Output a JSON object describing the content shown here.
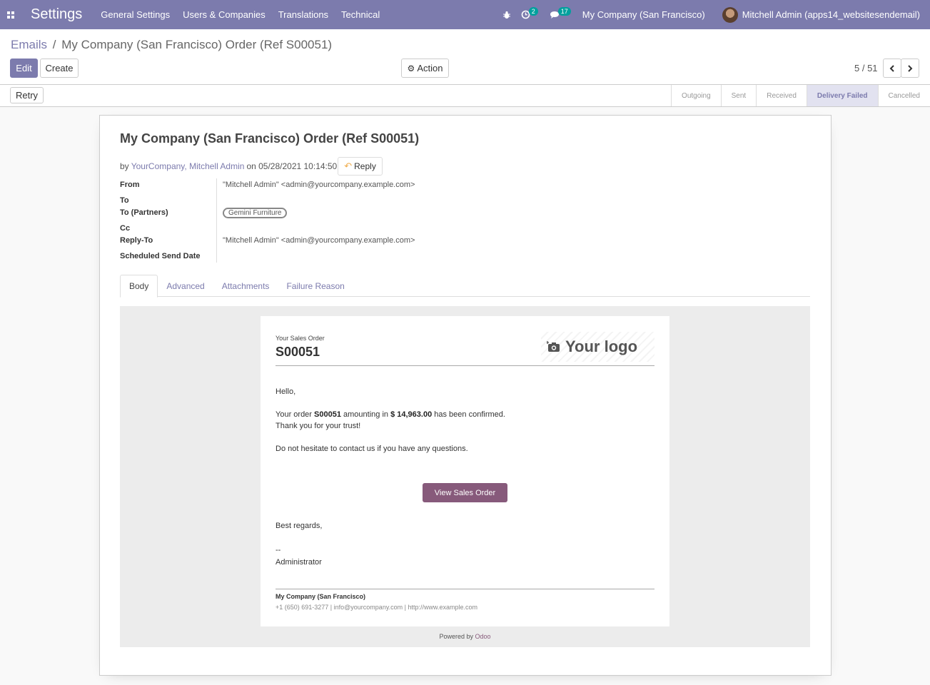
{
  "navbar": {
    "brand": "Settings",
    "menu": [
      "General Settings",
      "Users & Companies",
      "Translations",
      "Technical"
    ],
    "activity_count": "2",
    "message_count": "17",
    "company": "My Company (San Francisco)",
    "user": "Mitchell Admin (apps14_websitesendemail)"
  },
  "breadcrumb": {
    "parent": "Emails",
    "separator": "/",
    "current": "My Company (San Francisco) Order (Ref S00051)"
  },
  "buttons": {
    "edit": "Edit",
    "create": "Create",
    "action": "Action",
    "retry": "Retry"
  },
  "pager": {
    "value": "5 / 51"
  },
  "stages": [
    {
      "label": "Outgoing",
      "active": false
    },
    {
      "label": "Sent",
      "active": false
    },
    {
      "label": "Received",
      "active": false
    },
    {
      "label": "Delivery Failed",
      "active": true
    },
    {
      "label": "Cancelled",
      "active": false
    }
  ],
  "record": {
    "title": "My Company (San Francisco) Order (Ref S00051)",
    "by_prefix": "by",
    "authors": "YourCompany, Mitchell Admin",
    "on_date": "on 05/28/2021 10:14:50",
    "reply_label": "Reply"
  },
  "fields": {
    "from_label": "From",
    "from_value": "\"Mitchell Admin\" <admin@yourcompany.example.com>",
    "to_label": "To",
    "to_partners_label": "To (Partners)",
    "to_partners_tag": "Gemini Furniture",
    "cc_label": "Cc",
    "reply_to_label": "Reply-To",
    "reply_to_value": "\"Mitchell Admin\" <admin@yourcompany.example.com>",
    "scheduled_label": "Scheduled Send Date"
  },
  "tabs": [
    "Body",
    "Advanced",
    "Attachments",
    "Failure Reason"
  ],
  "email": {
    "small_heading": "Your Sales Order",
    "ref": "S00051",
    "logo_text": "Your logo",
    "hello": "Hello,",
    "line1_a": "Your order ",
    "line1_ref": "S00051",
    "line1_b": " amounting in ",
    "line1_amount": "$ 14,963.00",
    "line1_c": " has been confirmed.",
    "line2": "Thank you for your trust!",
    "line3": "Do not hesitate to contact us if you have any questions.",
    "cta": "View Sales Order",
    "regards": "Best regards,",
    "dashes": "--",
    "signature": "Administrator",
    "footer_company": "My Company (San Francisco)",
    "footer_contact": "+1 (650) 691-3277 | info@yourcompany.com | http://www.example.com",
    "powered_prefix": "Powered by",
    "powered_brand": "Odoo"
  },
  "colors": {
    "brand": "#7c7bad",
    "cta": "#875a7b"
  }
}
